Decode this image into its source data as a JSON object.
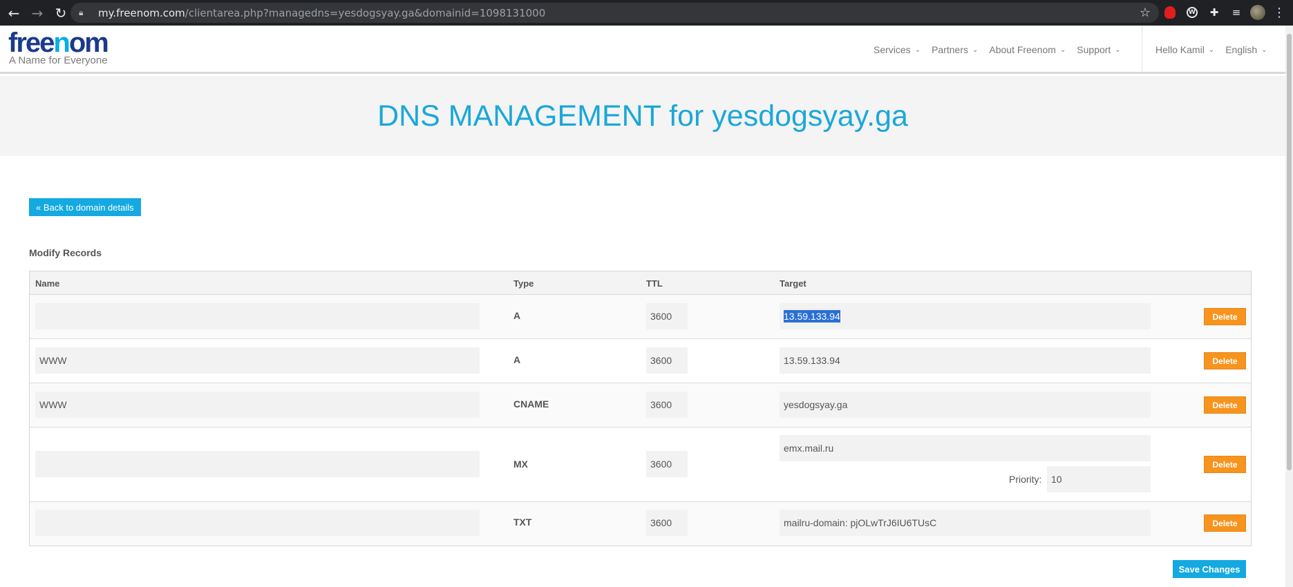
{
  "browser": {
    "url_host": "my.freenom.com",
    "url_path": "/clientarea.php?managedns=yesdogsyay.ga&domainid=1098131000"
  },
  "logo": {
    "word_a": "free",
    "word_o": "n",
    "word_b": "om",
    "tagline": "A Name for Everyone"
  },
  "nav": {
    "items": [
      {
        "label": "Services"
      },
      {
        "label": "Partners"
      },
      {
        "label": "About Freenom"
      },
      {
        "label": "Support"
      }
    ],
    "user": "Hello Kamil",
    "language": "English"
  },
  "banner": {
    "title": "DNS MANAGEMENT for yesdogsyay.ga"
  },
  "back_button": "« Back to domain details",
  "section_title": "Modify Records",
  "table": {
    "headers": {
      "name": "Name",
      "type": "Type",
      "ttl": "TTL",
      "target": "Target"
    },
    "rows": [
      {
        "name": "",
        "type": "A",
        "ttl": "3600",
        "target": "13.59.133.94",
        "delete": "Delete"
      },
      {
        "name": "WWW",
        "type": "A",
        "ttl": "3600",
        "target": "13.59.133.94",
        "delete": "Delete"
      },
      {
        "name": "WWW",
        "type": "CNAME",
        "ttl": "3600",
        "target": "yesdogsyay.ga",
        "delete": "Delete"
      },
      {
        "name": "",
        "type": "MX",
        "ttl": "3600",
        "target": "emx.mail.ru",
        "priority_label": "Priority:",
        "priority": "10",
        "delete": "Delete"
      },
      {
        "name": "",
        "type": "TXT",
        "ttl": "3600",
        "target": "mailru-domain: pjOLwTrJ6IU6TUsC",
        "delete": "Delete"
      }
    ]
  },
  "save_button": "Save Changes",
  "colors": {
    "brand_blue": "#14a9e0",
    "delete_orange": "#f7941d",
    "title_blue": "#1ba8d8"
  }
}
